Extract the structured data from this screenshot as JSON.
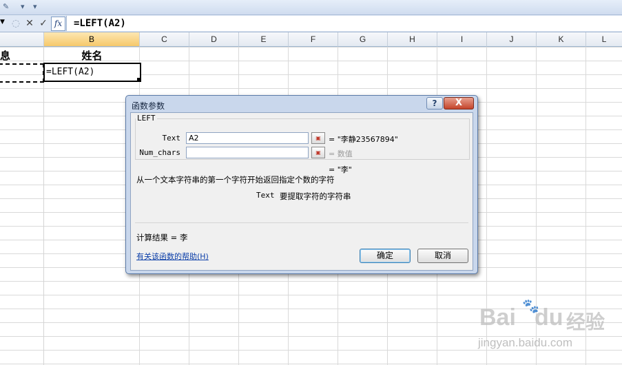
{
  "formula_bar": {
    "formula": "=LEFT(A2)",
    "fx_label": "fx"
  },
  "columns": [
    "B",
    "C",
    "D",
    "E",
    "F",
    "G",
    "H",
    "I",
    "J",
    "K",
    "L"
  ],
  "cells": {
    "a1_partial": "息",
    "b1": "姓名",
    "b2": "=LEFT(A2)"
  },
  "dialog": {
    "title": "函数参数",
    "help_btn": "?",
    "close_btn": "X",
    "function_name": "LEFT",
    "args": [
      {
        "label": "Text",
        "value": "A2",
        "result": "= \"李静23567894\""
      },
      {
        "label": "Num_chars",
        "value": "",
        "result": "= 数值"
      }
    ],
    "formula_result_line": "= \"李\"",
    "function_desc": "从一个文本字符串的第一个字符开始返回指定个数的字符",
    "arg_desc_name": "Text",
    "arg_desc": "要提取字符的字符串",
    "calc_result": "计算结果 =  李",
    "help_link": "有关该函数的帮助(H)",
    "ok_label": "确定",
    "cancel_label": "取消"
  },
  "watermark": {
    "brand": "Bai",
    "brand2": "du",
    "brand_cn": "经验",
    "url": "jingyan.baidu.com"
  }
}
